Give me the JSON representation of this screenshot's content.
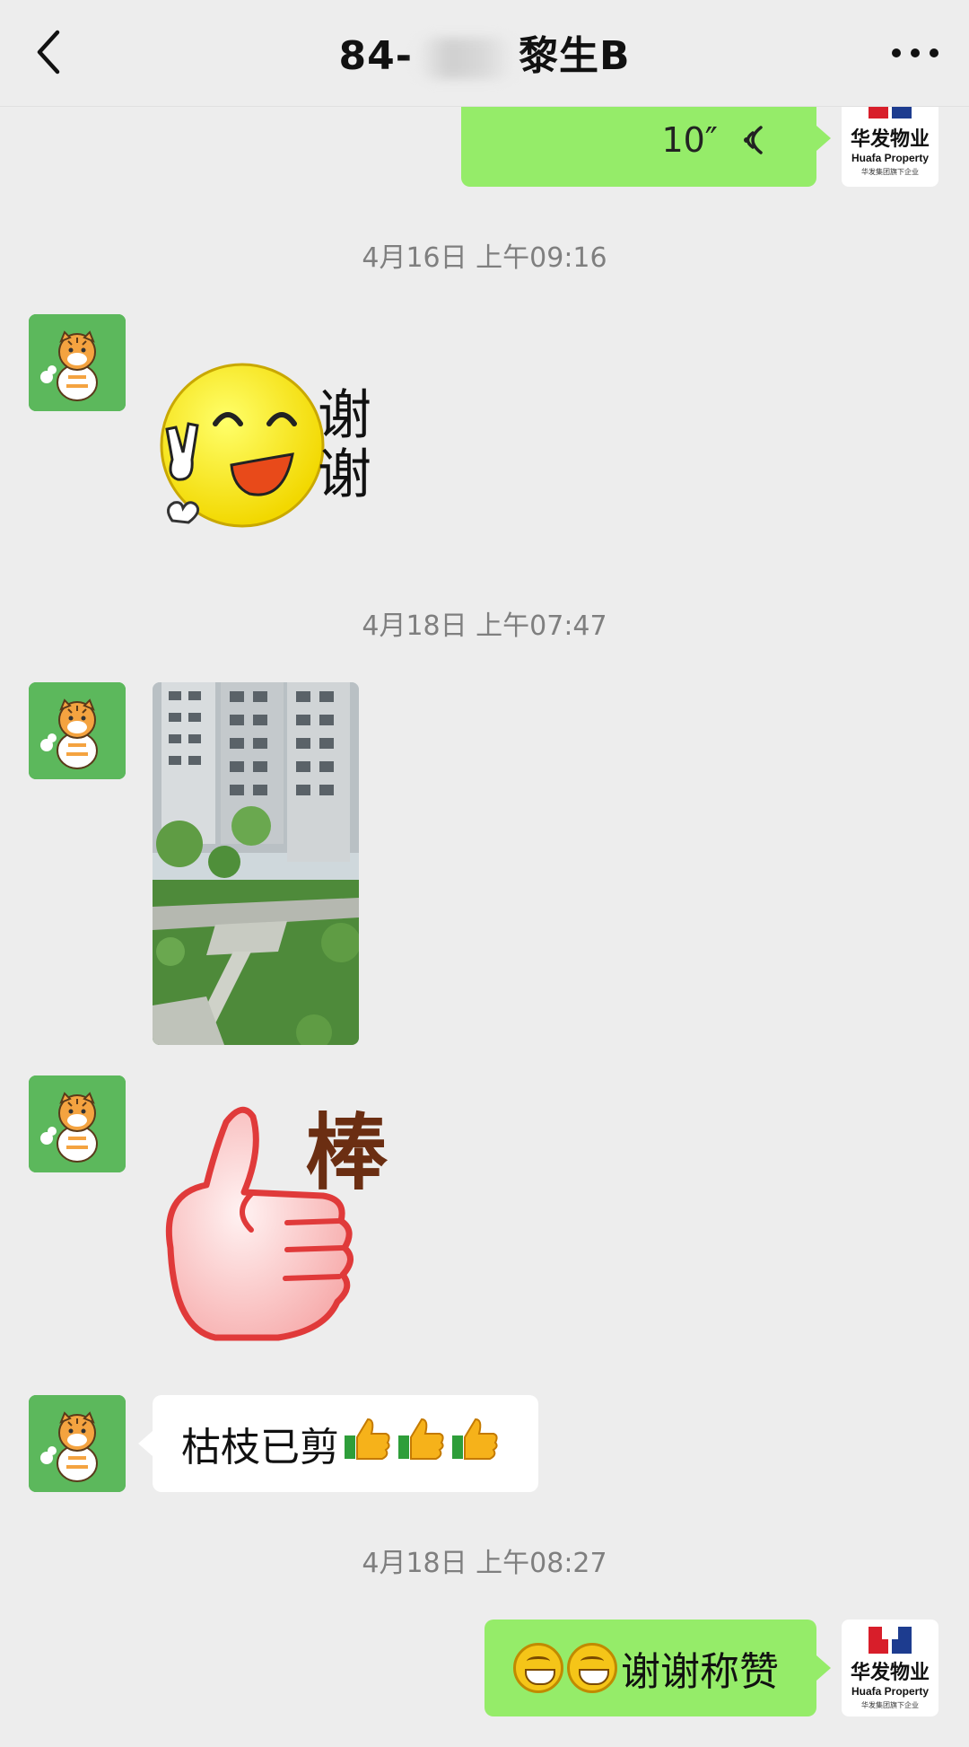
{
  "header": {
    "title_prefix": "84-",
    "title_suffix": "黎生B"
  },
  "messages": {
    "voice": {
      "duration": "10″"
    },
    "time1": "4月16日 上午09:16",
    "sticker1": {
      "text_line1": "谢",
      "text_line2": "谢"
    },
    "time2": "4月18日 上午07:47",
    "sticker2": {
      "text": "棒"
    },
    "text1": {
      "text": "枯枝已剪"
    },
    "time3": "4月18日 上午08:27",
    "text2": {
      "text": "谢谢称赞"
    }
  },
  "logo": {
    "brand_cn": "华发物业",
    "brand_en": "Huafa Property",
    "tagline": "华发集团旗下企业"
  },
  "colors": {
    "background": "#ededed",
    "sent_bubble": "#95ec69",
    "received_bubble": "#ffffff",
    "avatar_green": "#5cb85c"
  }
}
